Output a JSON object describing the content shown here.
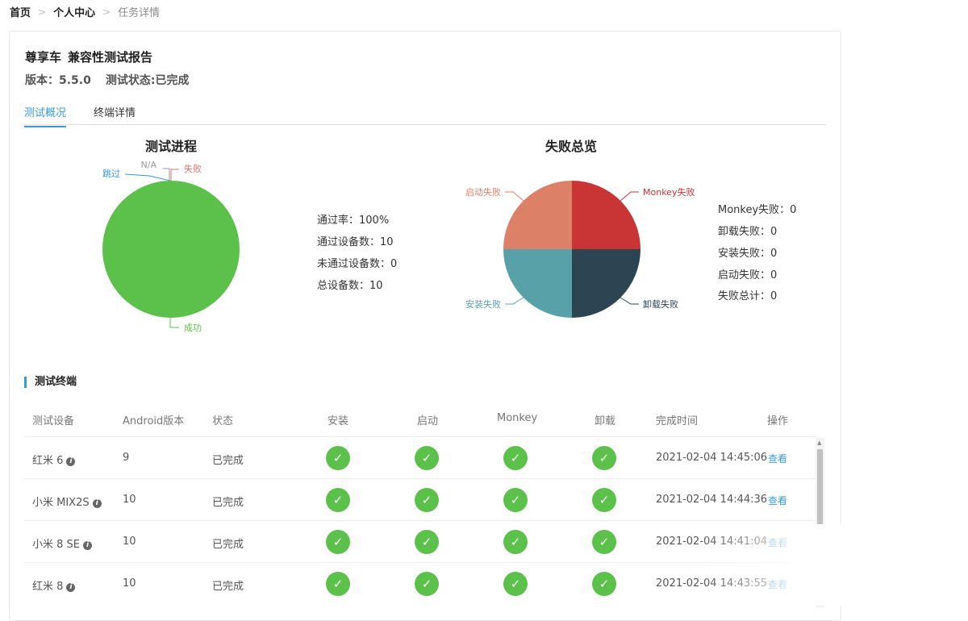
{
  "breadcrumb": {
    "home": "首页",
    "center": "个人中心",
    "current": "任务详情"
  },
  "report": {
    "app": "尊享车",
    "name": "兼容性测试报告",
    "version_label": "版本：5.5.0",
    "status_label": "测试状态:已完成"
  },
  "tabs": [
    {
      "label": "测试概况",
      "active": true
    },
    {
      "label": "终端详情",
      "active": false
    }
  ],
  "progress": {
    "title": "测试进程",
    "stats": [
      "通过率：100%",
      "通过设备数：10",
      "未通过设备数：0",
      "总设备数：10"
    ]
  },
  "failure": {
    "title": "失败总览",
    "stats": [
      "Monkey失败：0",
      "卸载失败：0",
      "安装失败：0",
      "启动失败：0",
      "失败总计：0"
    ]
  },
  "chart_data": [
    {
      "type": "pie",
      "title": "测试进程",
      "slices": [
        {
          "label": "成功",
          "value": 100,
          "color": "#5bc14a"
        },
        {
          "label": "跳过",
          "value": 0,
          "color": "#3a9ad9"
        },
        {
          "label": "N/A",
          "value": 0,
          "color": "#999999"
        },
        {
          "label": "失败",
          "value": 0,
          "color": "#e07070"
        }
      ]
    },
    {
      "type": "pie",
      "title": "失败总览",
      "slices": [
        {
          "label": "Monkey失败",
          "value": 25,
          "color": "#c93434"
        },
        {
          "label": "卸载失败",
          "value": 25,
          "color": "#2d4452"
        },
        {
          "label": "安装失败",
          "value": 25,
          "color": "#58a1a8"
        },
        {
          "label": "启动失败",
          "value": 25,
          "color": "#dc8068"
        }
      ]
    }
  ],
  "section_title": "测试终端",
  "table": {
    "headers": [
      "测试设备",
      "Android版本",
      "状态",
      "安装",
      "启动",
      "Monkey",
      "卸载",
      "完成时间",
      "操作"
    ],
    "rows": [
      {
        "device": "红米 6",
        "android": "9",
        "status": "已完成",
        "time": "2021-02-04 14:45:06",
        "action": "查看"
      },
      {
        "device": "小米 MIX2S",
        "android": "10",
        "status": "已完成",
        "time": "2021-02-04 14:44:36",
        "action": "查看"
      },
      {
        "device": "小米 8 SE",
        "android": "10",
        "status": "已完成",
        "time": "2021-02-04 14:41:04",
        "action": "查看"
      },
      {
        "device": "红米 8",
        "android": "10",
        "status": "已完成",
        "time": "2021-02-04 14:43:55",
        "action": "查看"
      }
    ]
  },
  "colors": {
    "accent": "#3a9ad9",
    "success": "#5bc14a"
  },
  "icons": {
    "check": "check-icon",
    "info": "info-icon",
    "breadcrumb_sep": "chevron-right-icon"
  }
}
